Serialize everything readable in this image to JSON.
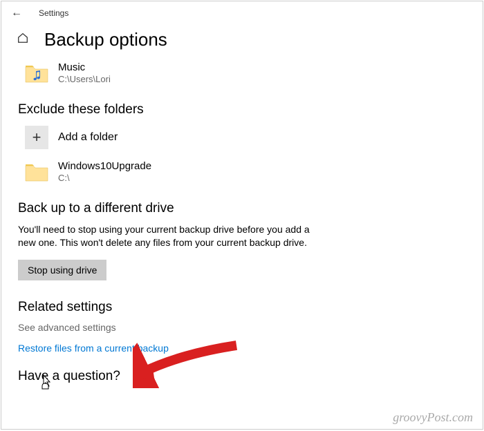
{
  "titlebar": {
    "label": "Settings"
  },
  "header": {
    "page_title": "Backup options"
  },
  "included_folder": {
    "name": "Music",
    "path": "C:\\Users\\Lori"
  },
  "exclude": {
    "heading": "Exclude these folders",
    "add_label": "Add a folder",
    "items": [
      {
        "name": "Windows10Upgrade",
        "path": "C:\\"
      }
    ]
  },
  "different_drive": {
    "heading": "Back up to a different drive",
    "body": "You'll need to stop using your current backup drive before you add a new one. This won't delete any files from your current backup drive.",
    "button": "Stop using drive"
  },
  "related": {
    "heading": "Related settings",
    "advanced_link": "See advanced settings",
    "restore_link": "Restore files from a current backup"
  },
  "cutoff_heading": "Have a question?",
  "watermark": "groovyPost.com"
}
